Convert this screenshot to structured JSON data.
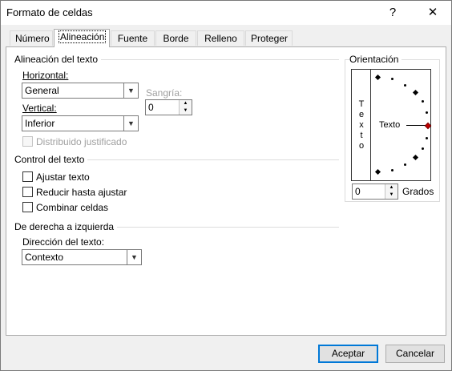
{
  "window": {
    "title": "Formato de celdas",
    "help_label": "?",
    "close_label": "✕"
  },
  "tabs": [
    {
      "label": "Número"
    },
    {
      "label": "Alineación"
    },
    {
      "label": "Fuente"
    },
    {
      "label": "Borde"
    },
    {
      "label": "Relleno"
    },
    {
      "label": "Proteger"
    }
  ],
  "alignment": {
    "group_label": "Alineación del texto",
    "horizontal_label": "Horizontal:",
    "horizontal_value": "General",
    "vertical_label": "Vertical:",
    "vertical_value": "Inferior",
    "indent_label": "Sangría:",
    "indent_value": "0",
    "justify_distributed_label": "Distribuido justificado"
  },
  "text_control": {
    "group_label": "Control del texto",
    "wrap_label": "Ajustar texto",
    "shrink_label": "Reducir hasta ajustar",
    "merge_label": "Combinar celdas"
  },
  "rtl": {
    "group_label": "De derecha a izquierda",
    "direction_label": "Dirección del texto:",
    "direction_value": "Contexto"
  },
  "orientation": {
    "group_label": "Orientación",
    "vertical_letters": [
      "T",
      "e",
      "x",
      "t",
      "o"
    ],
    "horizontal_text": "Texto",
    "degrees_value": "0",
    "degrees_label": "Grados",
    "indicator_color": "#c00000"
  },
  "footer": {
    "ok_label": "Aceptar",
    "cancel_label": "Cancelar"
  }
}
